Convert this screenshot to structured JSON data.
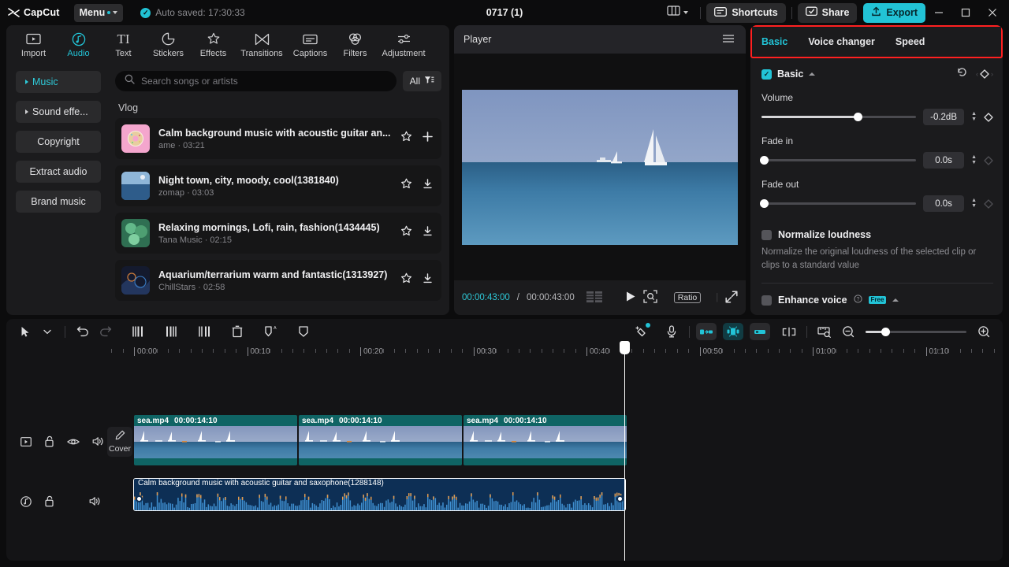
{
  "titlebar": {
    "app_name": "CapCut",
    "logo_icon": "capcut-logo-icon",
    "menu_label": "Menu",
    "autosave_text": "Auto saved: 17:30:33",
    "project_title": "0717 (1)",
    "layout_icon": "layout-icon",
    "shortcuts_label": "Shortcuts",
    "shortcuts_icon": "keyboard-icon",
    "share_label": "Share",
    "share_icon": "share-icon",
    "export_label": "Export",
    "export_icon": "upload-icon",
    "minimize_icon": "minimize-icon",
    "maximize_icon": "maximize-icon",
    "close_icon": "close-icon",
    "accent_color": "#22c3d6"
  },
  "nav_tabs": [
    {
      "label": "Import",
      "icon": "import-icon",
      "active": false
    },
    {
      "label": "Audio",
      "icon": "music-note-icon",
      "active": true
    },
    {
      "label": "Text",
      "icon": "text-icon",
      "active": false
    },
    {
      "label": "Stickers",
      "icon": "sticker-icon",
      "active": false
    },
    {
      "label": "Effects",
      "icon": "sparkle-icon",
      "active": false
    },
    {
      "label": "Transitions",
      "icon": "transition-icon",
      "active": false
    },
    {
      "label": "Captions",
      "icon": "captions-icon",
      "active": false
    },
    {
      "label": "Filters",
      "icon": "filters-icon",
      "active": false
    },
    {
      "label": "Adjustment",
      "icon": "adjustment-icon",
      "active": false
    }
  ],
  "sidebar": {
    "items": [
      {
        "label": "Music",
        "expandable": true,
        "active": true
      },
      {
        "label": "Sound effe...",
        "expandable": true,
        "active": false
      },
      {
        "label": "Copyright",
        "expandable": false,
        "active": false
      },
      {
        "label": "Extract audio",
        "expandable": false,
        "active": false
      },
      {
        "label": "Brand music",
        "expandable": false,
        "active": false
      }
    ]
  },
  "search": {
    "placeholder": "Search songs or artists",
    "icon": "search-icon",
    "filter_label": "All",
    "filter_icon": "filter-icon"
  },
  "music_list": {
    "category": "Vlog",
    "songs": [
      {
        "title": "Calm background music with acoustic guitar an...",
        "artist": "ame",
        "duration": "03:21",
        "meta": "ame · 03:21",
        "favorite_icon": "star-icon",
        "action_icon": "plus-icon",
        "cover_color": "#f0a0c8"
      },
      {
        "title": "Night town, city, moody, cool(1381840)",
        "artist": "zomap",
        "duration": "03:03",
        "meta": "zomap · 03:03",
        "favorite_icon": "star-icon",
        "action_icon": "download-icon",
        "cover_color": "#4a7ba6"
      },
      {
        "title": "Relaxing mornings, Lofi, rain, fashion(1434445)",
        "artist": "Tana Music",
        "duration": "02:15",
        "meta": "Tana Music · 02:15",
        "favorite_icon": "star-icon",
        "action_icon": "download-icon",
        "cover_color": "#3f7a5a"
      },
      {
        "title": "Aquarium/terrarium warm and fantastic(1313927)",
        "artist": "ChillStars",
        "duration": "02:58",
        "meta": "ChillStars · 02:58",
        "favorite_icon": "star-icon",
        "action_icon": "download-icon",
        "cover_color": "#1e2740"
      }
    ]
  },
  "player": {
    "title": "Player",
    "menu_icon": "hamburger-icon",
    "current_time": "00:00:43:00",
    "separator": "/",
    "total_time": "00:00:43:00",
    "frames_icon": "frames-icon",
    "play_icon": "play-icon",
    "magnify_icon": "magnifier-icon",
    "ratio_label": "Ratio",
    "fullscreen_icon": "fullscreen-icon"
  },
  "right_panel": {
    "tabs": [
      {
        "label": "Basic",
        "active": true
      },
      {
        "label": "Voice changer",
        "active": false
      },
      {
        "label": "Speed",
        "active": false
      }
    ],
    "highlight_color": "#ff2020",
    "basic_section": {
      "title": "Basic",
      "checked": true,
      "reset_icon": "reset-icon",
      "keyframe_icon": "keyframe-icon",
      "fields": [
        {
          "label": "Volume",
          "value": "-0.2dB",
          "slider_pct": 62,
          "keyframe_active": true
        },
        {
          "label": "Fade in",
          "value": "0.0s",
          "slider_pct": 0,
          "keyframe_active": false
        },
        {
          "label": "Fade out",
          "value": "0.0s",
          "slider_pct": 0,
          "keyframe_active": false
        }
      ]
    },
    "normalize": {
      "title": "Normalize loudness",
      "checked": false,
      "description": "Normalize the original loudness of the selected clip or clips to a standard value"
    },
    "enhance_voice": {
      "title": "Enhance voice",
      "checked": false,
      "help_icon": "help-icon",
      "badge": "Free"
    }
  },
  "timeline": {
    "toolbar_left": [
      {
        "icon": "select-arrow-icon",
        "state": "normal"
      },
      {
        "icon": "chevron-down-icon",
        "state": "normal"
      },
      {
        "icon": "undo-icon",
        "state": "normal"
      },
      {
        "icon": "redo-icon",
        "state": "disabled"
      },
      {
        "icon": "split-left-icon",
        "state": "normal"
      },
      {
        "icon": "split-right-icon",
        "state": "normal"
      },
      {
        "icon": "split-icon",
        "state": "normal"
      },
      {
        "icon": "delete-icon",
        "state": "normal"
      },
      {
        "icon": "ai-mask-icon",
        "state": "normal"
      },
      {
        "icon": "mask-icon",
        "state": "normal"
      }
    ],
    "toolbar_right": [
      {
        "icon": "auto-magic-icon",
        "state": "badge"
      },
      {
        "icon": "microphone-icon",
        "state": "normal"
      },
      {
        "icon": "align-left-icon",
        "state": "chip"
      },
      {
        "icon": "auto-cut-icon",
        "state": "chip-active"
      },
      {
        "icon": "align-right-icon",
        "state": "chip"
      },
      {
        "icon": "split-clip-icon",
        "state": "normal"
      },
      {
        "icon": "ruler-icon",
        "state": "normal"
      },
      {
        "icon": "zoom-out-icon",
        "state": "normal"
      },
      {
        "icon": "zoom-in-icon",
        "state": "normal"
      }
    ],
    "ruler_labels": [
      "00:00",
      "00:10",
      "00:20",
      "00:30",
      "00:40",
      "00:50",
      "01:00",
      "01:10"
    ],
    "playhead_time": "00:00:43:00",
    "video_track": {
      "head_icons": [
        "video-track-icon",
        "unlock-icon",
        "eye-icon",
        "volume-icon"
      ],
      "cover_label": "Cover",
      "cover_icon": "pencil-icon",
      "clips": [
        {
          "name": "sea.mp4",
          "duration": "00:00:14:10"
        },
        {
          "name": "sea.mp4",
          "duration": "00:00:14:10"
        },
        {
          "name": "sea.mp4",
          "duration": "00:00:14:10"
        }
      ]
    },
    "audio_track": {
      "head_icons": [
        "audio-track-icon",
        "unlock-icon",
        "blank-icon",
        "volume-icon"
      ],
      "clip_label": "Calm background music with acoustic guitar and saxophone(1288148)"
    }
  }
}
